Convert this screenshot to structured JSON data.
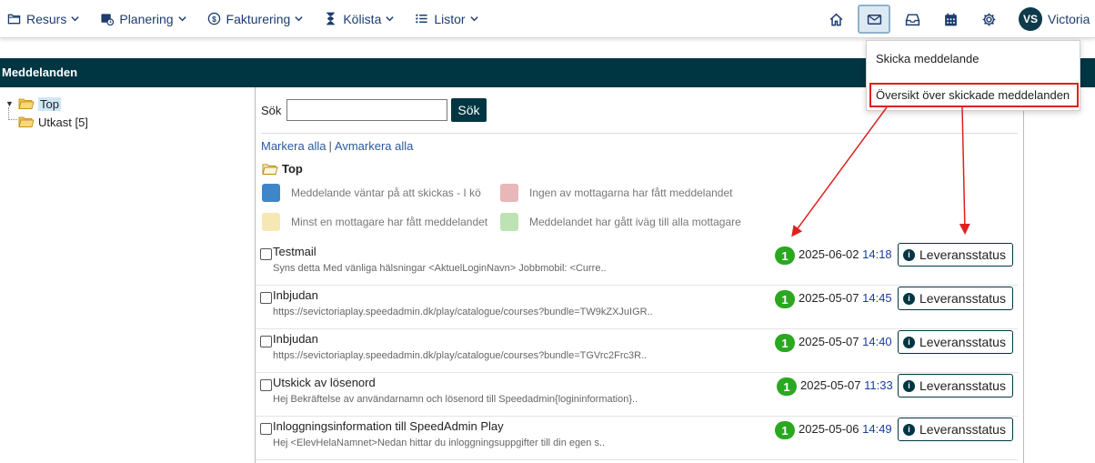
{
  "nav": {
    "items": [
      {
        "label": "Resurs",
        "icon": "folder-icon"
      },
      {
        "label": "Planering",
        "icon": "calendar-clock-icon"
      },
      {
        "label": "Fakturering",
        "icon": "dollar-circle-icon"
      },
      {
        "label": "Kölista",
        "icon": "hourglass-icon"
      },
      {
        "label": "Listor",
        "icon": "list-icon"
      }
    ],
    "right_icons": [
      "home-icon",
      "mail-icon",
      "inbox-icon",
      "calendar-icon",
      "gear-icon"
    ],
    "active_icon": "mail-icon",
    "avatar_initials": "VS",
    "username": "Victoria"
  },
  "dropdown": {
    "items": [
      "Skicka meddelande",
      "Översikt över skickade meddelanden"
    ],
    "highlighted_index": 1
  },
  "panel": {
    "title": "Meddelanden"
  },
  "tree": {
    "root": "Top",
    "child": "Utkast [5]"
  },
  "search": {
    "label": "Sök",
    "value": "",
    "button": "Sök"
  },
  "links": {
    "select_all": "Markera alla",
    "separator": "|",
    "deselect_all": "Avmarkera alla"
  },
  "folder_title": "Top",
  "legend": [
    {
      "label": "Meddelande väntar på att skickas - I kö",
      "color": "#3f86c8"
    },
    {
      "label": "Ingen av mottagarna har fått meddelandet",
      "color": "#e8b7b7"
    },
    {
      "label": "Minst en mottagare har fått meddelandet",
      "color": "#f6e8b2"
    },
    {
      "label": "Meddelandet har gått iväg till alla mottagare",
      "color": "#bde3b5"
    }
  ],
  "status_button_label": "Leveransstatus",
  "messages": [
    {
      "title": "Testmail",
      "preview": "Syns detta Med vänliga hälsningar <AktuelLoginNavn> Jobbmobil: <Curre..",
      "count": "1",
      "date": "2025-06-02",
      "time": "14:18"
    },
    {
      "title": "Inbjudan",
      "preview": "https://sevictoriaplay.speedadmin.dk/play/catalogue/courses?bundle=TW9kZXJuIGR..",
      "count": "1",
      "date": "2025-05-07",
      "time": "14:45"
    },
    {
      "title": "Inbjudan",
      "preview": "https://sevictoriaplay.speedadmin.dk/play/catalogue/courses?bundle=TGVrc2Frc3R..",
      "count": "1",
      "date": "2025-05-07",
      "time": "14:40"
    },
    {
      "title": "Utskick av lösenord",
      "preview": "Hej Bekräftelse av användarnamn och lösenord till Speedadmin{logininformation}..",
      "count": "1",
      "date": "2025-05-07",
      "time": "11:33"
    },
    {
      "title": "Inloggningsinformation till SpeedAdmin Play",
      "preview": "Hej <ElevHelaNamnet>Nedan hittar du inloggningsuppgifter till din egen s..",
      "count": "1",
      "date": "2025-05-06",
      "time": "14:49"
    }
  ],
  "colors": {
    "header_bg": "#003542",
    "nav_text": "#1d3c6e",
    "badge_green": "#2aa820",
    "highlight_red": "#e01f1f"
  }
}
